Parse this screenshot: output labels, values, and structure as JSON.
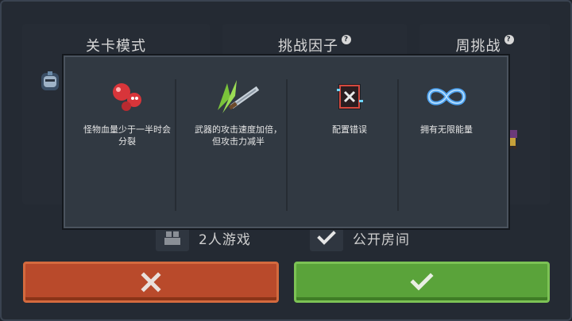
{
  "modes": [
    {
      "title": "关卡模式",
      "help": false
    },
    {
      "title": "挑战因子",
      "help": true
    },
    {
      "title": "周挑战",
      "help": true
    }
  ],
  "help_glyph": "?",
  "options": {
    "two_player": "2人游戏",
    "public_room": "公开房间"
  },
  "popup": {
    "factors": [
      {
        "icon": "red-splitting-monster-icon",
        "text": "怪物血量少于一半时会分裂"
      },
      {
        "icon": "green-sword-icon",
        "text": "武器的攻击速度加倍，但攻击力减半"
      },
      {
        "icon": "glitch-config-icon",
        "text": "配置错误"
      },
      {
        "icon": "infinity-icon",
        "text": "拥有无限能量"
      }
    ]
  },
  "buttons": {
    "cancel_icon": "x-icon",
    "confirm_icon": "check-icon"
  },
  "colors": {
    "cancel": "#b94a2b",
    "confirm": "#5aa33a",
    "popup_bg": "#313942"
  }
}
